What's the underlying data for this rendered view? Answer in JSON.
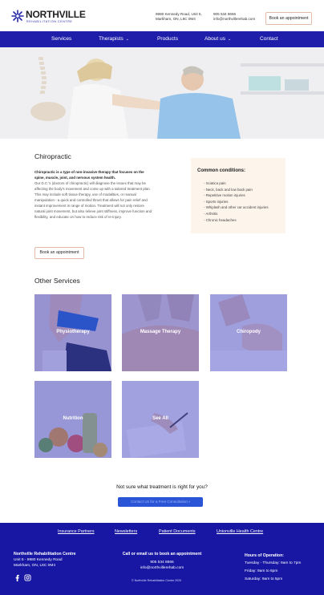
{
  "brand": {
    "name": "NORTHVILLE",
    "subtitle": "REHABILITATION CENTRE",
    "accent": "#1e1eaa",
    "peach": "#fdf4ec"
  },
  "header": {
    "address_line1": "9980 Kennedy Road, Unit 5,",
    "address_line2": "Markham, ON,  L6C 0M4",
    "phone": "905 534 8666",
    "email": "info@northvillerehab.com",
    "book_label": "Book an appointment"
  },
  "nav": {
    "items": [
      "Services",
      "Therapists",
      "Products",
      "About us",
      "Contact"
    ]
  },
  "chiropractic": {
    "title": "Chiropractic",
    "lead": "Chiropractic is a type of non-invasive therapy that focuses on the spine, muscle, joint, and nervous system health.",
    "body": "Our D.C.'s (doctors of chiropractic) will diagnose the issues that may be affecting the body's movement and come up with a tailored treatment plan. This may include soft tissue therapy, use of modalities, or manual manipulation - a quick and controlled thrust that allows for pain relief and instant improvement in range of motion. Treatment will not only restore natural joint movement, but also relieve joint stiffness, improve function and flexibility, and educate on how to reduce risk of re-injury.",
    "book_label": "Book an appointment"
  },
  "conditions": {
    "title": "Common conditions:",
    "items": [
      "Sciatica pain",
      "Neck, back and low back pain",
      "Repetitive motion injuries",
      "Sports injuries",
      "Whiplash and other car accident injuries",
      "Arthritis",
      "Chronic headaches"
    ]
  },
  "other_services": {
    "title": "Other Services",
    "tiles": [
      "Physiotherapy",
      "Massage Therapy",
      "Chiropody",
      "Nutrition",
      "See All"
    ]
  },
  "cta": {
    "question": "Not sure what treatment is right for you?",
    "button_label": "Contact Us for a Free Consultation"
  },
  "footer": {
    "links": [
      "Insurance Partners",
      "Newsletters",
      "Patient Documents",
      "Unionville Health Centre"
    ],
    "centre_name": "Northville Rehabilitation Centre",
    "address_line1": "Unit 5 - 9980 Kennedy Road",
    "address_line2": "Markham, ON, L6C 0M4",
    "call_heading": "Call or email us to book an appointment",
    "phone": "905 534 8666",
    "email": "info@northvillerehab.com",
    "copyright": "© Northville Rehabilitation Centre 2020",
    "hours_heading": "Hours of Operation:",
    "hours": [
      "Tuesday - Thursday: 9am to 7pm",
      "Friday: 9am to 6pm",
      "Saturday: 9am to 5pm"
    ],
    "social_icons": [
      "facebook-icon",
      "instagram-icon"
    ]
  }
}
